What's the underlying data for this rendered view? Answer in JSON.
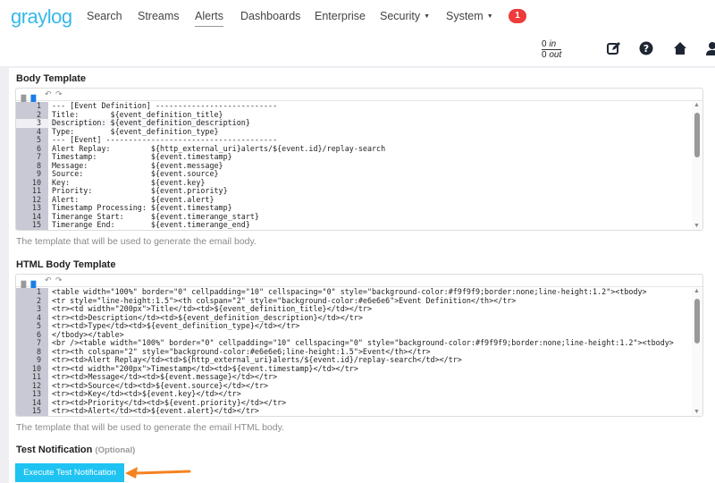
{
  "header": {
    "logo": "graylog",
    "nav": [
      "Search",
      "Streams",
      "Alerts",
      "Dashboards",
      "Enterprise",
      "Security",
      "System"
    ],
    "notification_count": "1",
    "throughput_in": "0",
    "throughput_in_label": "in",
    "throughput_out": "0",
    "throughput_out_label": "out"
  },
  "body_template": {
    "label": "Body Template",
    "help": "The template that will be used to generate the email body.",
    "lines": [
      "--- [Event Definition] ---------------------------",
      "Title:       ${event_definition_title}",
      "Description: ${event_definition_description}",
      "Type:        ${event_definition_type}",
      "--- [Event] --------------------------------------",
      "Alert Replay:         ${http_external_uri}alerts/${event.id}/replay-search",
      "Timestamp:            ${event.timestamp}",
      "Message:              ${event.message}",
      "Source:               ${event.source}",
      "Key:                  ${event.key}",
      "Priority:             ${event.priority}",
      "Alert:                ${event.alert}",
      "Timestamp Processing: ${event.timestamp}",
      "Timerange Start:      ${event.timerange_start}",
      "Timerange End:        ${event.timerange_end}"
    ]
  },
  "html_body_template": {
    "label": "HTML Body Template",
    "help": "The template that will be used to generate the email HTML body.",
    "lines": [
      "<table width=\"100%\" border=\"0\" cellpadding=\"10\" cellspacing=\"0\" style=\"background-color:#f9f9f9;border:none;line-height:1.2\"><tbody>",
      "<tr style=\"line-height:1.5\"><th colspan=\"2\" style=\"background-color:#e6e6e6\">Event Definition</th></tr>",
      "<tr><td width=\"200px\">Title</td><td>${event_definition_title}</td></tr>",
      "<tr><td>Description</td><td>${event_definition_description}</td></tr>",
      "<tr><td>Type</td><td>${event_definition_type}</td></tr>",
      "</tbody></table>",
      "<br /><table width=\"100%\" border=\"0\" cellpadding=\"10\" cellspacing=\"0\" style=\"background-color:#f9f9f9;border:none;line-height:1.2\"><tbody>",
      "<tr><th colspan=\"2\" style=\"background-color:#e6e6e6;line-height:1.5\">Event</th></tr>",
      "<tr><td>Alert Replay</td><td>${http_external_uri}alerts/${event.id}/replay-search</td></tr>",
      "<tr><td width=\"200px\">Timestamp</td><td>${event.timestamp}</td></tr>",
      "<tr><td>Message</td><td>${event.message}</td></tr>",
      "<tr><td>Source</td><td>${event.source}</td></tr>",
      "<tr><td>Key</td><td>${event.key}</td></tr>",
      "<tr><td>Priority</td><td>${event.priority}</td></tr>",
      "<tr><td>Alert</td><td>${event.alert}</td></tr>"
    ]
  },
  "test": {
    "label": "Test Notification",
    "optional": "(Optional)",
    "button": "Execute Test Notification"
  },
  "colors": {
    "accent": "#1ec3f2",
    "arrow": "#f58220",
    "badge": "#ee3b3b"
  }
}
